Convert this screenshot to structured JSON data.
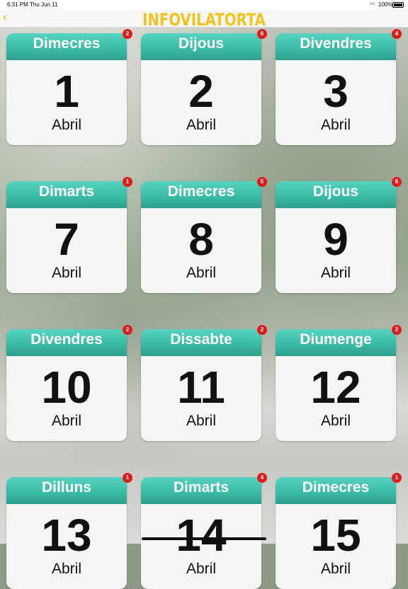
{
  "status": {
    "time": "6:31 PM",
    "date": "Thu Jun 11",
    "battery": "100%"
  },
  "nav": {
    "back_icon": "chevron-left-icon",
    "title": "INFOVILATORTA"
  },
  "colors": {
    "header_teal": "#3bbca7",
    "title_yellow": "#f2c31d",
    "badge_red": "#e01b1b"
  },
  "days": [
    {
      "weekday": "Dimecres",
      "day": "1",
      "month": "Abril",
      "badge": "2"
    },
    {
      "weekday": "Dijous",
      "day": "2",
      "month": "Abril",
      "badge": "6"
    },
    {
      "weekday": "Divendres",
      "day": "3",
      "month": "Abril",
      "badge": "4"
    },
    {
      "weekday": "Dimarts",
      "day": "7",
      "month": "Abril",
      "badge": "1"
    },
    {
      "weekday": "Dimecres",
      "day": "8",
      "month": "Abril",
      "badge": "5"
    },
    {
      "weekday": "Dijous",
      "day": "9",
      "month": "Abril",
      "badge": "6"
    },
    {
      "weekday": "Divendres",
      "day": "10",
      "month": "Abril",
      "badge": "2"
    },
    {
      "weekday": "Dissabte",
      "day": "11",
      "month": "Abril",
      "badge": "2"
    },
    {
      "weekday": "Diumenge",
      "day": "12",
      "month": "Abril",
      "badge": "2"
    },
    {
      "weekday": "Dilluns",
      "day": "13",
      "month": "Abril",
      "badge": "1"
    },
    {
      "weekday": "Dimarts",
      "day": "14",
      "month": "Abril",
      "badge": "4"
    },
    {
      "weekday": "Dimecres",
      "day": "15",
      "month": "Abril",
      "badge": "1"
    }
  ]
}
